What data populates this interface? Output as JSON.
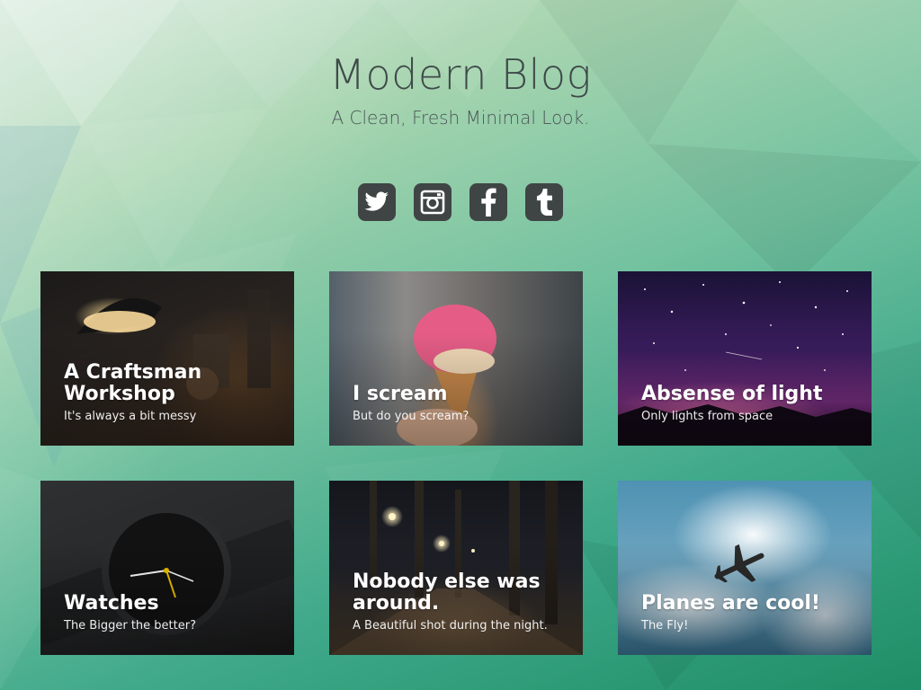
{
  "header": {
    "title": "Modern Blog",
    "tagline": "A Clean, Fresh Minimal Look."
  },
  "social": [
    {
      "icon": "twitter-icon",
      "color": "#3f4545"
    },
    {
      "icon": "instagram-icon",
      "color": "#3f4545"
    },
    {
      "icon": "facebook-icon",
      "color": "#3f4545"
    },
    {
      "icon": "tumblr-icon",
      "color": "#3f4545"
    }
  ],
  "posts": [
    {
      "title": "A Craftsman Workshop",
      "subtitle": "It's always a bit messy"
    },
    {
      "title": "I scream",
      "subtitle": "But do you scream?"
    },
    {
      "title": "Absense of light",
      "subtitle": "Only lights from space"
    },
    {
      "title": "Watches",
      "subtitle": "The Bigger the better?"
    },
    {
      "title": "Nobody else was around.",
      "subtitle": "A Beautiful shot during the night."
    },
    {
      "title": "Planes are cool!",
      "subtitle": "The Fly!"
    }
  ],
  "colors": {
    "title_text": "#3f4a4a",
    "icon_bg": "#3f4545",
    "bg_light": "#cfe6d6",
    "bg_dark": "#1f8e66"
  }
}
